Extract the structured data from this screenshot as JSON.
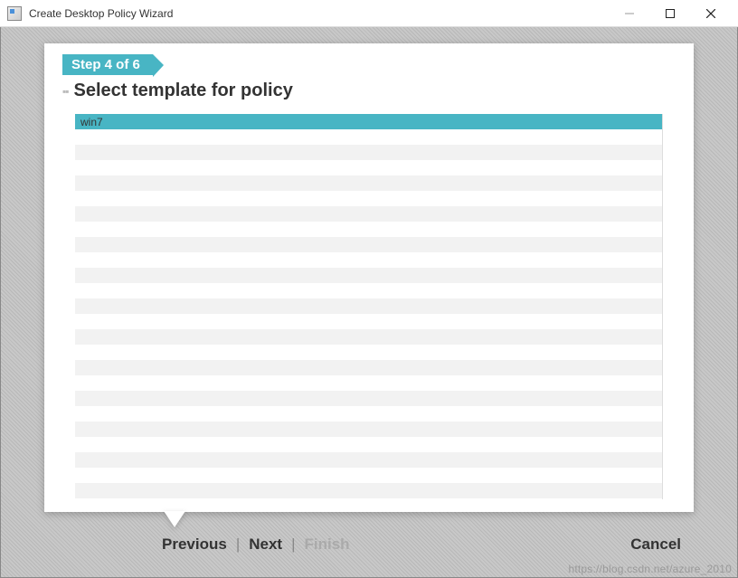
{
  "window": {
    "title": "Create Desktop Policy Wizard"
  },
  "step": {
    "badge": "Step 4 of 6",
    "title": "Select template for policy"
  },
  "templates": {
    "items": [
      {
        "label": "win7",
        "selected": true
      }
    ],
    "emptyRows": 24
  },
  "nav": {
    "previous": "Previous",
    "next": "Next",
    "finish": "Finish",
    "cancel": "Cancel",
    "separator": "|"
  },
  "watermark": "https://blog.csdn.net/azure_2010"
}
